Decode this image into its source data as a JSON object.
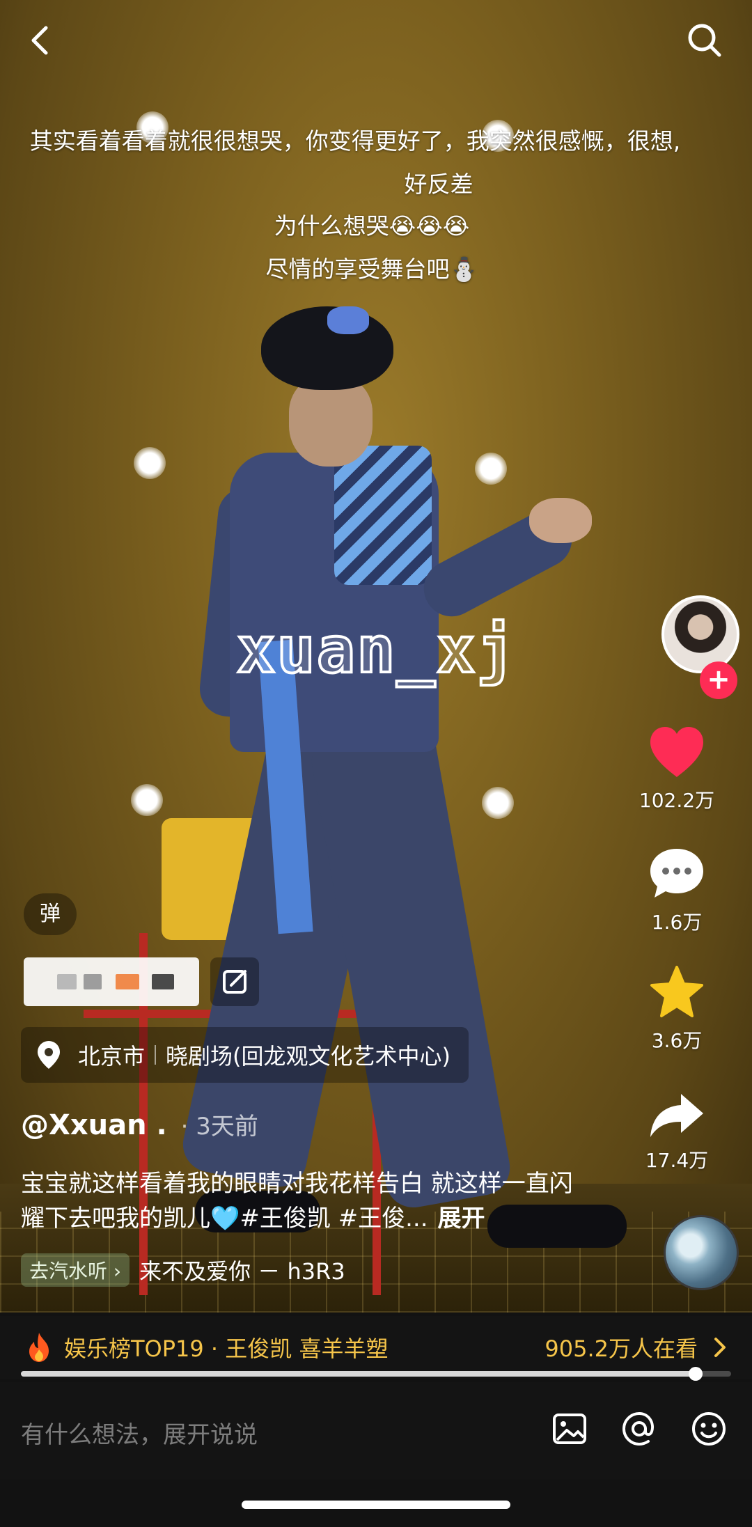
{
  "danmaku": [
    "其实看着看着就很很想哭，你变得更好了，我突然很感慨，很想,",
    "好反差",
    "为什么想哭😭😭😭",
    "尽情的享受舞台吧⛄"
  ],
  "watermark": "xuan_xj",
  "sidebar": {
    "likes": "102.2万",
    "comments": "1.6万",
    "favorites": "3.6万",
    "shares": "17.4万"
  },
  "danmu_toggle": "弹",
  "location": {
    "city": "北京市",
    "venue": "晓剧场(回龙观文化艺术中心)"
  },
  "author": {
    "name": "@Xxuan .",
    "time": "· 3天前"
  },
  "description": {
    "text": "宝宝就这样看着我的眼睛对我花样告白 就这样一直闪耀下去吧我的凯儿🩵#王俊凯 #王俊...",
    "expand": "展开"
  },
  "music": {
    "listen_label": "去汽水听 ›",
    "title": "来不及爱你 － h3R3"
  },
  "ranking": {
    "label": "娱乐榜TOP19 · 王俊凯 喜羊羊塑",
    "watching": "905.2万人在看"
  },
  "progress": 0.95,
  "comment": {
    "placeholder": "有什么想法，展开说说"
  },
  "colors": {
    "like": "#fe2c55",
    "favorite": "#f8c81e",
    "rank": "#f6c54a"
  }
}
